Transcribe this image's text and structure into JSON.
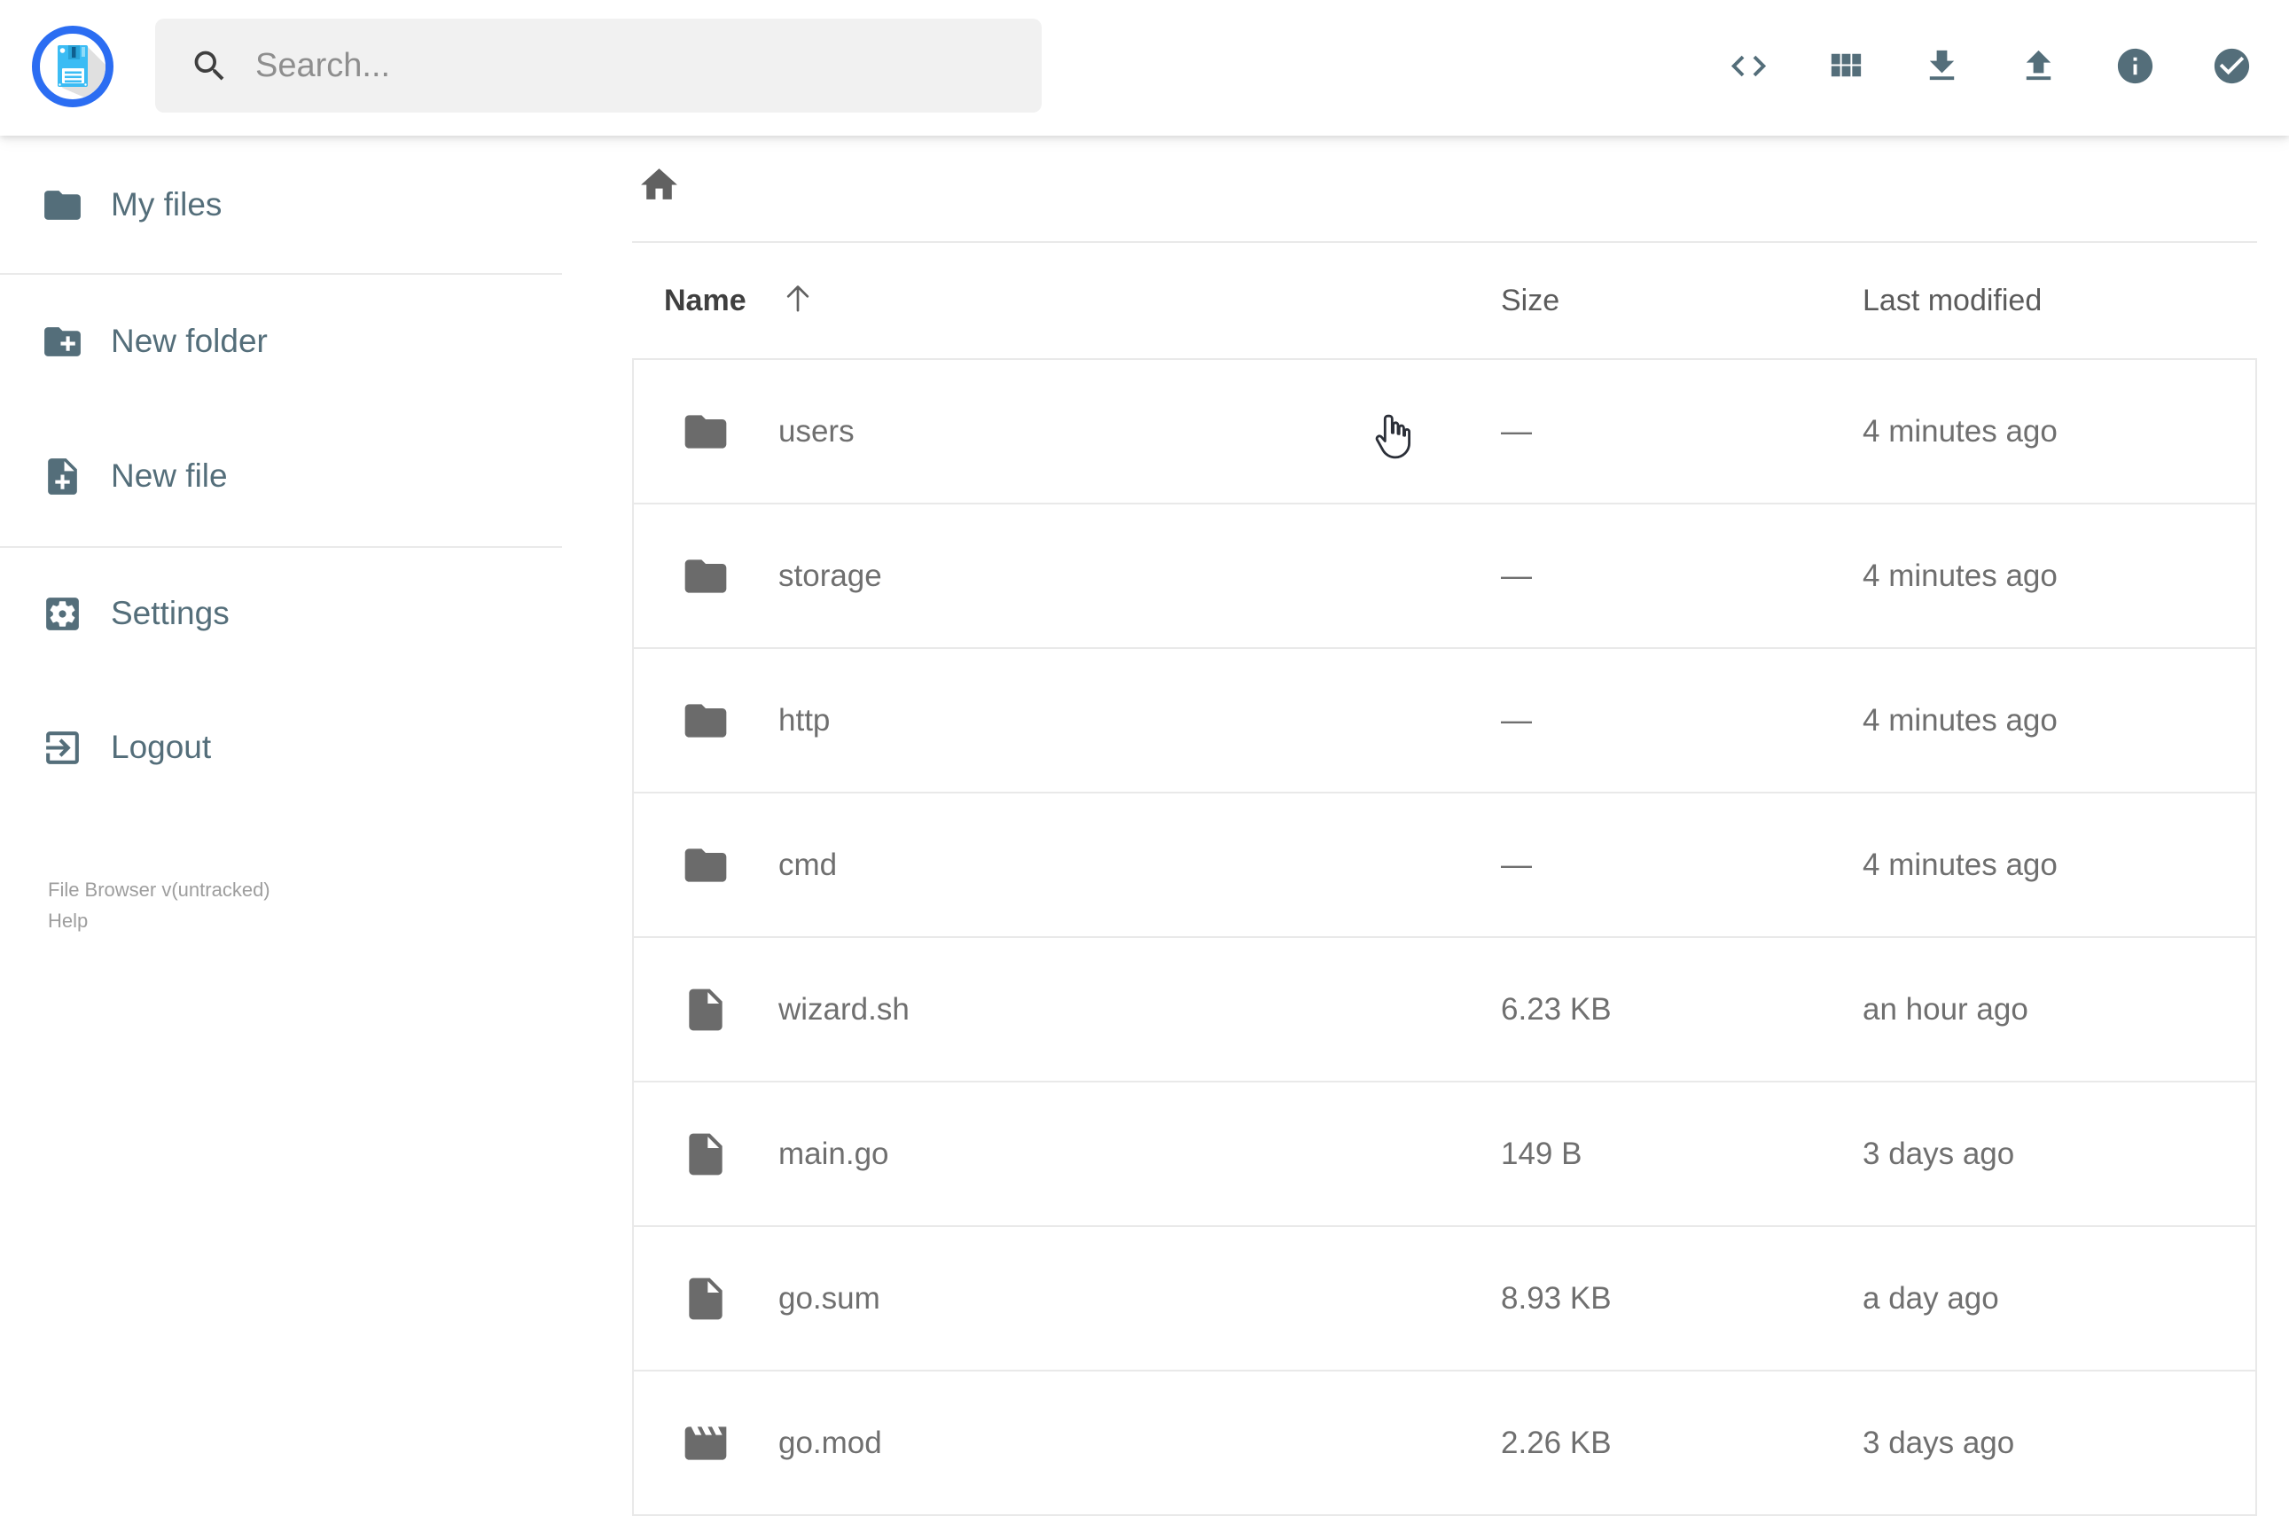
{
  "header": {
    "logo": {
      "icon": "floppy-disk-logo"
    },
    "search": {
      "placeholder": "Search...",
      "icon": "search-icon"
    },
    "actions": [
      {
        "label": "Shell",
        "icon": "code-icon"
      },
      {
        "label": "Switch view",
        "icon": "grid-view-icon"
      },
      {
        "label": "Download",
        "icon": "download-icon"
      },
      {
        "label": "Upload",
        "icon": "upload-icon"
      },
      {
        "label": "Info",
        "icon": "info-icon"
      },
      {
        "label": "Select multiple",
        "icon": "check-circle-icon"
      }
    ]
  },
  "sidebar": {
    "items": [
      {
        "label": "My files",
        "icon": "folder-icon"
      },
      {
        "label": "New folder",
        "icon": "new-folder-icon"
      },
      {
        "label": "New file",
        "icon": "new-file-icon"
      },
      {
        "label": "Settings",
        "icon": "settings-icon"
      },
      {
        "label": "Logout",
        "icon": "logout-icon"
      }
    ],
    "footer": {
      "version": "File Browser v(untracked)",
      "help": "Help"
    }
  },
  "breadcrumb": {
    "home_icon": "home-icon"
  },
  "listing": {
    "sort": {
      "column": "Name",
      "direction": "asc",
      "arrow_icon": "arrow-up-icon"
    },
    "columns": [
      {
        "label": "Name"
      },
      {
        "label": "Size"
      },
      {
        "label": "Last modified"
      }
    ],
    "rows": [
      {
        "name": "users",
        "type": "folder",
        "icon": "folder-icon",
        "size": "—",
        "modified": "4 minutes ago"
      },
      {
        "name": "storage",
        "type": "folder",
        "icon": "folder-icon",
        "size": "—",
        "modified": "4 minutes ago"
      },
      {
        "name": "http",
        "type": "folder",
        "icon": "folder-icon",
        "size": "—",
        "modified": "4 minutes ago"
      },
      {
        "name": "cmd",
        "type": "folder",
        "icon": "folder-icon",
        "size": "—",
        "modified": "4 minutes ago"
      },
      {
        "name": "wizard.sh",
        "type": "file",
        "icon": "file-icon",
        "size": "6.23 KB",
        "modified": "an hour ago"
      },
      {
        "name": "main.go",
        "type": "file",
        "icon": "file-icon",
        "size": "149 B",
        "modified": "3 days ago"
      },
      {
        "name": "go.sum",
        "type": "file",
        "icon": "file-icon",
        "size": "8.93 KB",
        "modified": "a day ago"
      },
      {
        "name": "go.mod",
        "type": "file",
        "icon": "movie-icon",
        "size": "2.26 KB",
        "modified": "3 days ago"
      }
    ]
  },
  "cursor": {
    "type": "hand-pointer"
  },
  "colors": {
    "accent": "#2b6df2",
    "slate": "#546e7a",
    "icon_gray": "#6b6b6b",
    "cell_text": "#6f6f6f",
    "header_text": "#3f3f3f",
    "border": "#e9e9e9",
    "footer_text": "#9e9e9e",
    "search_bg": "#f1f1f1",
    "floppy_cyan": "#3bbcf4"
  }
}
